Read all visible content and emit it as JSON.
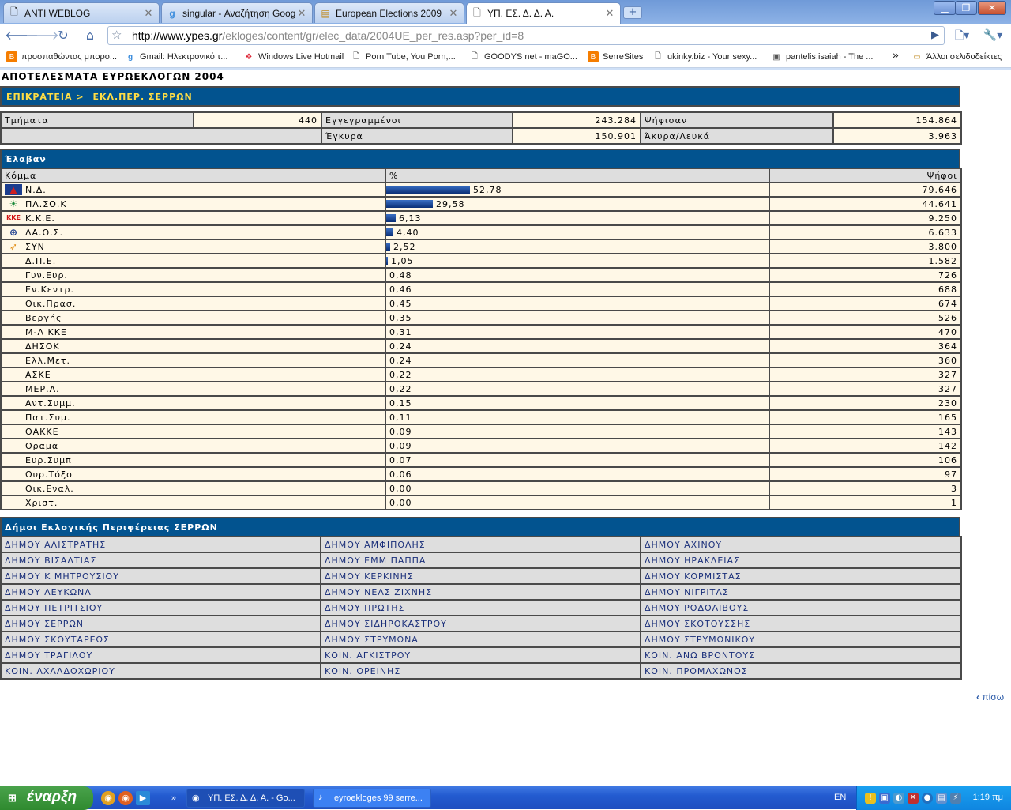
{
  "browser": {
    "tabs": [
      {
        "label": "ANTI WEBLOG",
        "icon": "page-icon"
      },
      {
        "label": "singular - Αναζήτηση Google",
        "icon": "google-icon"
      },
      {
        "label": "European Elections 2009",
        "icon": "folder-icon"
      },
      {
        "label": "ΥΠ. ΕΣ. Δ. Δ. Α.",
        "icon": "page-icon"
      }
    ],
    "url_host": "http://www.ypes.gr",
    "url_path": "/ekloges/content/gr/elec_data/2004UE_per_res.asp?per_id=8",
    "bookmarks": [
      {
        "label": "προσπαθώντας μπορο...",
        "icon": "blogger-icon"
      },
      {
        "label": "Gmail: Ηλεκτρονικό τ...",
        "icon": "google-icon"
      },
      {
        "label": "Windows Live Hotmail",
        "icon": "windows-icon"
      },
      {
        "label": "Porn Tube, You Porn,...",
        "icon": "page-icon"
      },
      {
        "label": "GOODYS net - maGO...",
        "icon": "page-icon"
      },
      {
        "label": "SerreSites",
        "icon": "blogger-icon"
      },
      {
        "label": "ukinky.biz - Your sexy...",
        "icon": "page-icon"
      },
      {
        "label": "pantelis.isaiah - The ...",
        "icon": "page-icon"
      }
    ],
    "overflow": "»",
    "other_bookmarks": "Άλλοι σελιδοδείκτες"
  },
  "page": {
    "title": "ΑΠΟΤΕΛΕΣΜΑΤΑ ΕΥΡΩΕΚΛΟΓΩΝ 2004",
    "breadcrumb_root": "ΕΠΙΚΡΑΤΕΙΑ",
    "breadcrumb_sep": ">",
    "breadcrumb_current": "ΕΚΛ.ΠΕΡ. ΣΕΡΡΩΝ",
    "stats": {
      "sections_label": "Τμήματα",
      "sections_value": "440",
      "registered_label": "Εγγεγραμμένοι",
      "registered_value": "243.284",
      "voted_label": "Ψήφισαν",
      "voted_value": "154.864",
      "valid_label": "Έγκυρα",
      "valid_value": "150.901",
      "invalid_label": "Άκυρα/Λευκά",
      "invalid_value": "3.963"
    },
    "results_header": "Έλαβαν",
    "columns": {
      "party": "Κόμμα",
      "percent": "%",
      "votes": "Ψήφοι"
    },
    "back_link": "πίσω",
    "municipalities_header": "Δήμοι Εκλογικής Περιφέρειας ΣΕΡΡΩΝ",
    "municipalities": [
      [
        "ΔΗΜΟΥ ΑΛΙΣΤΡΑΤΗΣ",
        "ΔΗΜΟΥ ΑΜΦΙΠΟΛΗΣ",
        "ΔΗΜΟΥ ΑΧΙΝΟΥ"
      ],
      [
        "ΔΗΜΟΥ ΒΙΣΑΛΤΙΑΣ",
        "ΔΗΜΟΥ ΕΜΜ ΠΑΠΠΑ",
        "ΔΗΜΟΥ ΗΡΑΚΛΕΙΑΣ"
      ],
      [
        "ΔΗΜΟΥ Κ ΜΗΤΡΟΥΣΙΟΥ",
        "ΔΗΜΟΥ ΚΕΡΚΙΝΗΣ",
        "ΔΗΜΟΥ ΚΟΡΜΙΣΤΑΣ"
      ],
      [
        "ΔΗΜΟΥ ΛΕΥΚΩΝΑ",
        "ΔΗΜΟΥ ΝΕΑΣ ΖΙΧΝΗΣ",
        "ΔΗΜΟΥ ΝΙΓΡΙΤΑΣ"
      ],
      [
        "ΔΗΜΟΥ ΠΕΤΡΙΤΣΙΟΥ",
        "ΔΗΜΟΥ ΠΡΩΤΗΣ",
        "ΔΗΜΟΥ ΡΟΔΟΛΙΒΟΥΣ"
      ],
      [
        "ΔΗΜΟΥ ΣΕΡΡΩΝ",
        "ΔΗΜΟΥ ΣΙΔΗΡΟΚΑΣΤΡΟΥ",
        "ΔΗΜΟΥ ΣΚΟΤΟΥΣΣΗΣ"
      ],
      [
        "ΔΗΜΟΥ ΣΚΟΥΤΑΡΕΩΣ",
        "ΔΗΜΟΥ ΣΤΡΥΜΩΝΑ",
        "ΔΗΜΟΥ ΣΤΡΥΜΩΝΙΚΟΥ"
      ],
      [
        "ΔΗΜΟΥ ΤΡΑΓΙΛΟΥ",
        "ΚΟΙΝ. ΑΓΚΙΣΤΡΟΥ",
        "ΚΟΙΝ. ΑΝΩ ΒΡΟΝΤΟΥΣ"
      ],
      [
        "ΚΟΙΝ. ΑΧΛΑΔΟΧΩΡΙΟΥ",
        "ΚΟΙΝ. ΟΡΕΙΝΗΣ",
        "ΚΟΙΝ. ΠΡΟΜΑΧΩΝΟΣ"
      ]
    ]
  },
  "chart_data": {
    "type": "table",
    "categories": [
      "Ν.Δ.",
      "ΠΑ.ΣΟ.Κ",
      "Κ.Κ.Ε.",
      "ΛΑ.Ο.Σ.",
      "ΣΥΝ",
      "Δ.Π.Ε.",
      "Γυν.Ευρ.",
      "Εν.Κεντρ.",
      "Οικ.Πρασ.",
      "Βεργής",
      "Μ-Λ ΚΚΕ",
      "ΔΗΣΟΚ",
      "Ελλ.Μετ.",
      "ΑΣΚΕ",
      "ΜΕΡ.Α.",
      "Αντ.Συμμ.",
      "Πατ.Συμ.",
      "ΟΑΚΚΕ",
      "Οραμα",
      "Ευρ.Συμπ",
      "Ουρ.Τόξο",
      "Οικ.Εναλ.",
      "Χριστ."
    ],
    "series": [
      {
        "name": "%",
        "values": [
          52.78,
          29.58,
          6.13,
          4.4,
          2.52,
          1.05,
          0.48,
          0.46,
          0.45,
          0.35,
          0.31,
          0.24,
          0.24,
          0.22,
          0.22,
          0.15,
          0.11,
          0.09,
          0.09,
          0.07,
          0.06,
          0.0,
          0.0
        ]
      },
      {
        "name": "Ψήφοι",
        "values": [
          79646,
          44641,
          9250,
          6633,
          3800,
          1582,
          726,
          688,
          674,
          526,
          470,
          364,
          360,
          327,
          327,
          230,
          165,
          143,
          142,
          106,
          97,
          3,
          1
        ]
      }
    ],
    "percent_labels": [
      "52,78",
      "29,58",
      "6,13",
      "4,40",
      "2,52",
      "1,05",
      "0,48",
      "0,46",
      "0,45",
      "0,35",
      "0,31",
      "0,24",
      "0,24",
      "0,22",
      "0,22",
      "0,15",
      "0,11",
      "0,09",
      "0,09",
      "0,07",
      "0,06",
      "0,00",
      "0,00"
    ],
    "vote_labels": [
      "79.646",
      "44.641",
      "9.250",
      "6.633",
      "3.800",
      "1.582",
      "726",
      "688",
      "674",
      "526",
      "470",
      "364",
      "360",
      "327",
      "327",
      "230",
      "165",
      "143",
      "142",
      "106",
      "97",
      "3",
      "1"
    ],
    "bars_shown_for_first": 6,
    "party_logos": [
      "nd-logo-icon",
      "pasok-logo-icon",
      "kke-logo-icon",
      "laos-logo-icon",
      "syn-logo-icon"
    ],
    "bar_color": "#1f4fa8"
  },
  "taskbar": {
    "start_label": "έναρξη",
    "items": [
      {
        "label": "ΥΠ. ΕΣ. Δ. Δ. Α. - Go...",
        "icon": "chrome-icon"
      },
      {
        "label": "eyroekloges 99 serre...",
        "icon": "winamp-icon"
      }
    ],
    "language": "EN",
    "clock": "1:19 πμ"
  }
}
